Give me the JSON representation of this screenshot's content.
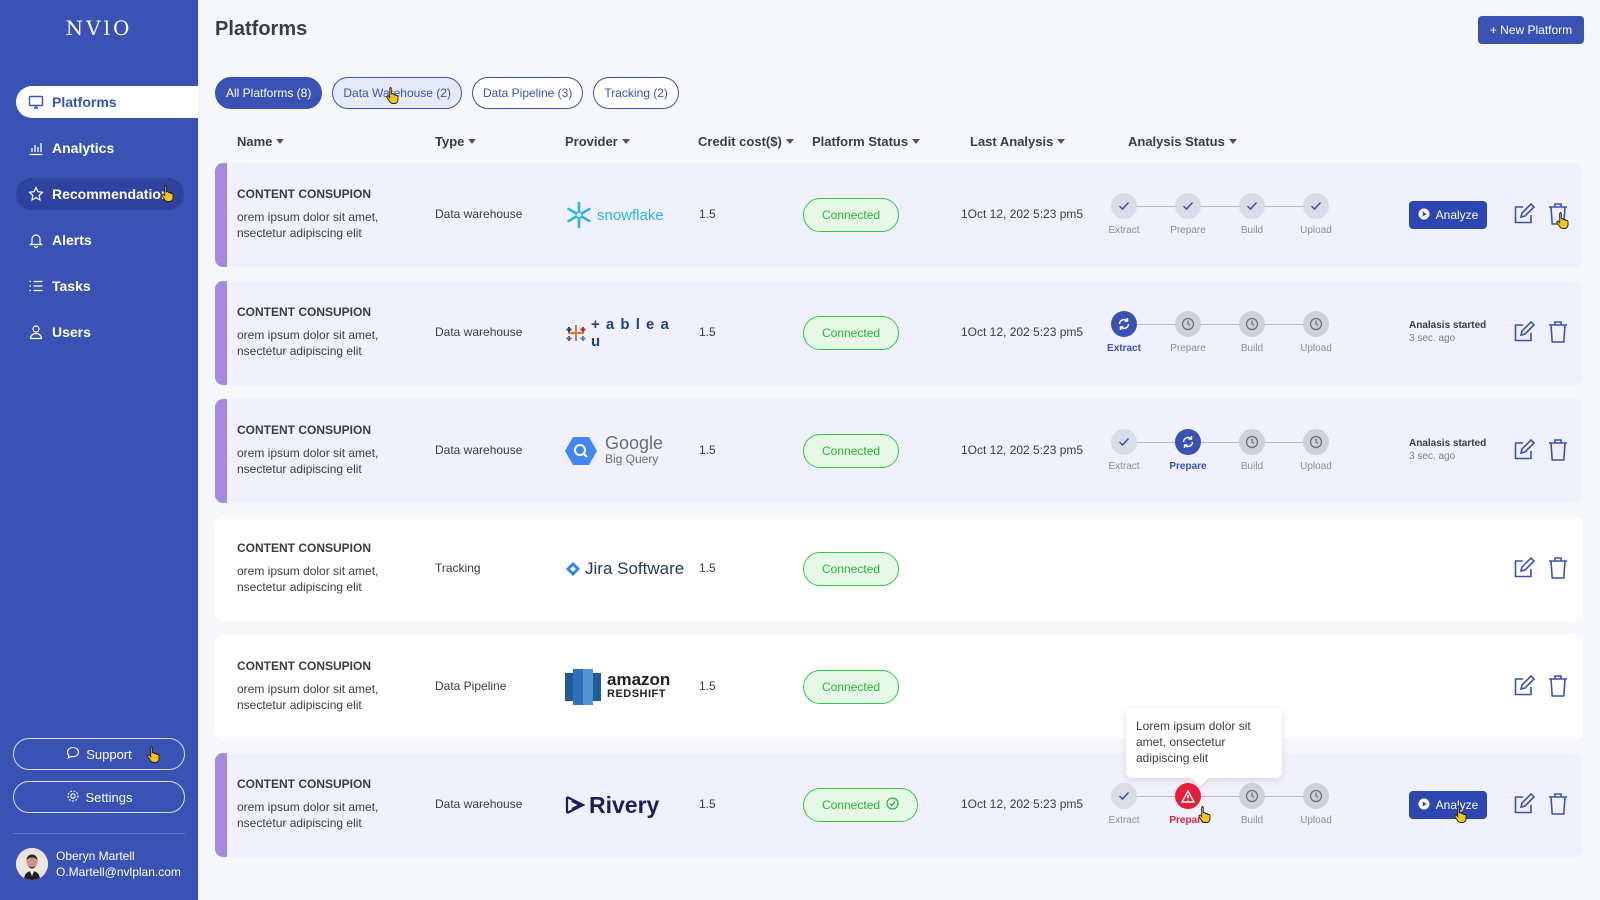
{
  "app": {
    "logo": "NVlO"
  },
  "sidebar": {
    "items": [
      {
        "label": "Platforms",
        "icon": "monitor-icon"
      },
      {
        "label": "Analytics",
        "icon": "bar-chart-icon"
      },
      {
        "label": "Recommendation",
        "icon": "star-icon"
      },
      {
        "label": "Alerts",
        "icon": "bell-icon"
      },
      {
        "label": "Tasks",
        "icon": "list-icon"
      },
      {
        "label": "Users",
        "icon": "user-icon"
      }
    ],
    "support_label": "Support",
    "settings_label": "Settings",
    "user": {
      "name": "Oberyn Martell",
      "email": "O.Martell@nvlplan.com"
    }
  },
  "header": {
    "title": "Platforms",
    "new_button": "+ New Platform"
  },
  "filters": [
    {
      "label": "All Platforms (8)"
    },
    {
      "label": "Data Warehouse (2)"
    },
    {
      "label": "Data Pipeline (3)"
    },
    {
      "label": "Tracking (2)"
    }
  ],
  "columns": {
    "name": "Name",
    "type": "Type",
    "provider": "Provider",
    "credit": "Credit cost($)",
    "platform_status": "Platform Status",
    "last_analysis": "Last Analysis",
    "analysis_status": "Analysis Status"
  },
  "steps": [
    "Extract",
    "Prepare",
    "Build",
    "Upload"
  ],
  "rows": [
    {
      "name": "CONTENT CONSUPION",
      "desc": "orem ipsum dolor sit amet, nsectetur adipiscing elit",
      "type": "Data warehouse",
      "provider": "snowflake",
      "credit": "1.5",
      "status": "Connected",
      "last": "1Oct 12, 202 5:23 pm5",
      "action": "Analyze"
    },
    {
      "name": "CONTENT CONSUPION",
      "desc": "orem ipsum dolor sit amet, nsectetur adipiscing elit",
      "type": "Data warehouse",
      "provider": "+ a b l e a u",
      "credit": "1.5",
      "status": "Connected",
      "last": "1Oct 12, 202 5:23 pm5",
      "started": "Analasis started",
      "started_ago": "3 sec. ago"
    },
    {
      "name": "CONTENT CONSUPION",
      "desc": "orem ipsum dolor sit amet, nsectetur adipiscing elit",
      "type": "Data warehouse",
      "provider": "Google",
      "provider_sub": "Big Query",
      "credit": "1.5",
      "status": "Connected",
      "last": "1Oct 12, 202 5:23 pm5",
      "started": "Analasis started",
      "started_ago": "3 sec. ago"
    },
    {
      "name": "CONTENT CONSUPION",
      "desc": "orem ipsum dolor sit amet, nsectetur adipiscing elit",
      "type": "Tracking",
      "provider": "Jira Software",
      "credit": "1.5",
      "status": "Connected"
    },
    {
      "name": "CONTENT CONSUPION",
      "desc": "orem ipsum dolor sit amet, nsectetur adipiscing elit",
      "type": "Data Pipeline",
      "provider": "amazon",
      "provider_sub": "REDSHIFT",
      "credit": "1.5",
      "status": "Connected"
    },
    {
      "name": "CONTENT CONSUPION",
      "desc": "orem ipsum dolor sit amet, nsectetur adipiscing elit",
      "type": "Data warehouse",
      "provider": "Rivery",
      "credit": "1.5",
      "status": "Connected",
      "last": "1Oct 12, 202 5:23 pm5",
      "action": "Analyze"
    }
  ],
  "tooltip": "Lorem ipsum dolor sit amet, onsectetur adipiscing elit",
  "colors": {
    "primary": "#3b52b5",
    "success": "#2bb33b",
    "error": "#e81f3a",
    "accent_bar": "#a58ae0"
  }
}
